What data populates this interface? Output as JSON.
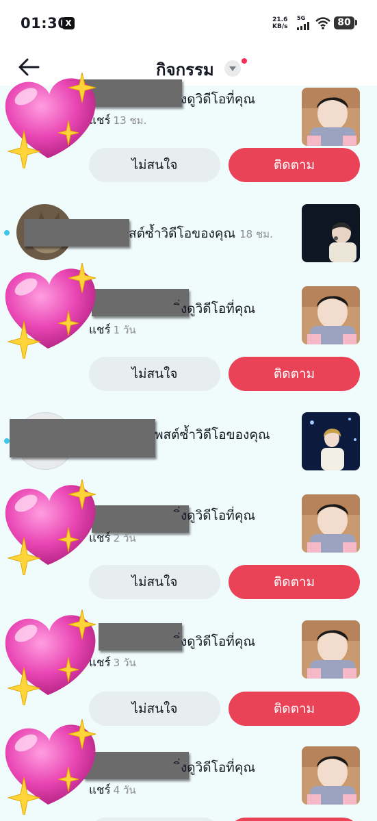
{
  "status_bar": {
    "time": "01:30",
    "notification_app": "X",
    "net_speed_value": "21.6",
    "net_speed_unit": "KB/s",
    "network_type": "5G",
    "battery": "80"
  },
  "header": {
    "title": "กิจกรรม",
    "back_icon": "arrow-left-icon",
    "dropdown_icon": "triangle-down-icon"
  },
  "buttons": {
    "not_interested": "ไม่สนใจ",
    "follow": "ติดตาม"
  },
  "items": [
    {
      "type": "follow-suggest",
      "text": "ิ่งดูวิดีโอที่คุณ",
      "meta": "แชร์",
      "time": "13 ชม."
    },
    {
      "type": "repost",
      "text": "สต์ซ้ำวิดีโอของคุณ",
      "time": "18 ชม."
    },
    {
      "type": "follow-suggest",
      "text": "ิ่งดูวิดีโอที่คุณ",
      "meta": "แชร์",
      "time": "1 วัน"
    },
    {
      "type": "repost",
      "text": "พสต์ซ้ำวิดีโอของคุณ"
    },
    {
      "type": "follow-suggest",
      "text": "ิ่งดูวิดีโอที่คุณ",
      "meta": "แชร์",
      "time": "2 วัน"
    },
    {
      "type": "follow-suggest",
      "text": "ิ่งดูวิดีโอที่คุณ",
      "meta": "แชร์",
      "time": "3 วัน"
    },
    {
      "type": "follow-suggest",
      "text": "ิ่งดูวิดีโอที่คุณ",
      "meta": "แชร์",
      "time": "4 วัน"
    }
  ],
  "colors": {
    "follow": "#ea4257",
    "not_interested": "#e6eef0",
    "unread": "#3dc6e8",
    "background": "#f0fbfc"
  }
}
